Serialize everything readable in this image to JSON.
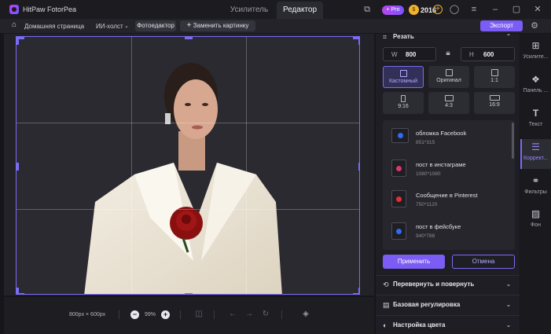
{
  "app": {
    "title": "HitPaw FotorPea"
  },
  "tabs": [
    {
      "label": "Усилитель"
    },
    {
      "label": "Редактор"
    }
  ],
  "titlebar": {
    "pro_badge": "+ Pro",
    "coin_icon": "coin-icon",
    "coins": "2016",
    "coin_plus": "+"
  },
  "toolbar": {
    "home_label": "Домашняя страница",
    "ai_canvas_label": "ИИ-холст",
    "photo_editor_label": "Фотоедактор",
    "replace_label": "Заменить картинку",
    "replace_plus": "+",
    "export_label": "Экспорт"
  },
  "canvas": {
    "photo_subject": "woman-in-white-blazer-with-red-rose"
  },
  "bottombar": {
    "size_text": "800px × 600px",
    "zoom": "99%",
    "zoom_out": "−",
    "zoom_in": "+"
  },
  "crop": {
    "section_title": "Резать",
    "width_label": "W",
    "width_value": "800",
    "height_label": "H",
    "height_value": "600",
    "ratios": [
      {
        "label": "Кастомный",
        "selected": true
      },
      {
        "label": "Оригинал"
      },
      {
        "label": "1:1"
      },
      {
        "label": "9:16"
      },
      {
        "label": "4:3"
      },
      {
        "label": "16:9"
      }
    ],
    "presets": [
      {
        "title": "обложка Facebook",
        "size": "851*315",
        "color": "#2f6cf0"
      },
      {
        "title": "пост в инстаграме",
        "size": "1080*1080",
        "color": "#d63a6a"
      },
      {
        "title": "Сообщение в Pinterest",
        "size": "750*1120",
        "color": "#e0303a"
      },
      {
        "title": "пост в фейсбуке",
        "size": "940*788",
        "color": "#2f6cf0"
      }
    ],
    "apply_label": "Применить",
    "cancel_label": "Отмена"
  },
  "sections": [
    {
      "title": "Перевернуть и повернуть"
    },
    {
      "title": "Базовая регулировка"
    },
    {
      "title": "Настройка цвета"
    }
  ],
  "sidebar": [
    {
      "label": "Усилите...",
      "icon": "add-image-icon"
    },
    {
      "label": "Панель ...",
      "icon": "panel-grid-icon"
    },
    {
      "label": "Текст",
      "icon": "text-icon"
    },
    {
      "label": "Коррект...",
      "icon": "sliders-icon",
      "active": true
    },
    {
      "label": "Фильтры",
      "icon": "filters-icon"
    },
    {
      "label": "Фон",
      "icon": "background-icon"
    }
  ],
  "colors": {
    "accent": "#7b5cf5",
    "crop_frame": "#7b6cf5"
  }
}
